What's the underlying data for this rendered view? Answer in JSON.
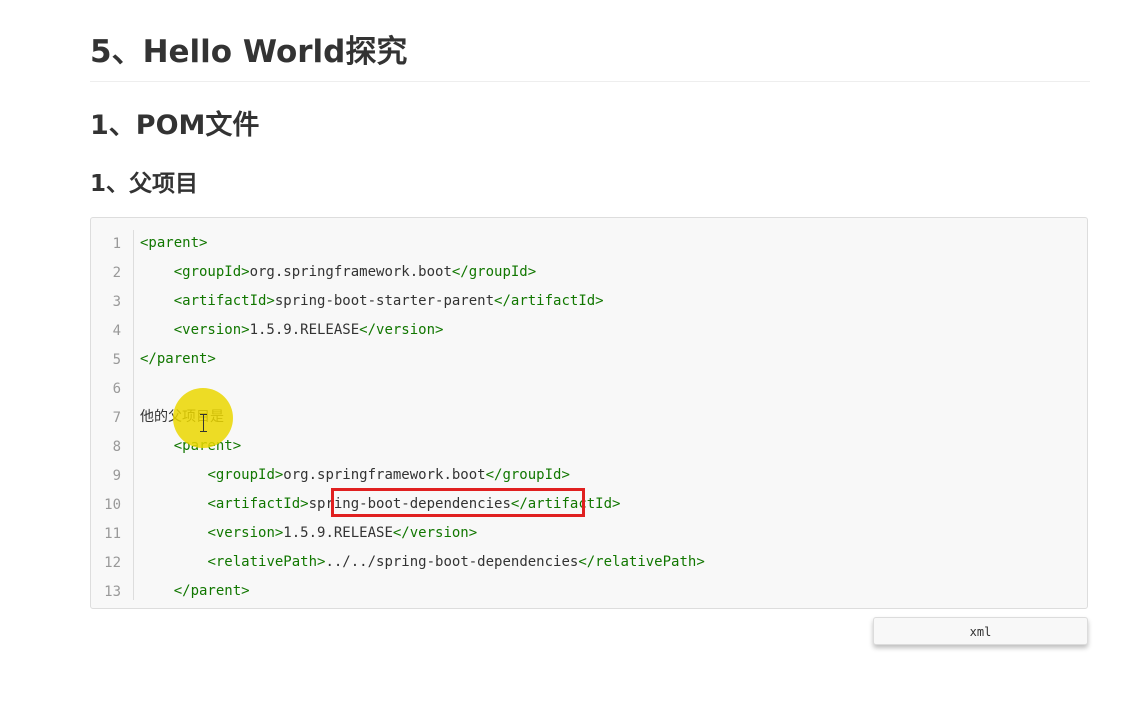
{
  "headings": {
    "main": "5、Hello World探究",
    "sub": "1、POM文件",
    "sub2": "1、父项目"
  },
  "code": {
    "line_numbers": [
      "1",
      "2",
      "3",
      "4",
      "5",
      "6",
      "7",
      "8",
      "9",
      "10",
      "11",
      "12",
      "13"
    ],
    "lines": {
      "l1_tag": "<parent>",
      "l2_open": "<groupId>",
      "l2_text": "org.springframework.boot",
      "l2_close": "</groupId>",
      "l3_open": "<artifactId>",
      "l3_text": "spring-boot-starter-parent",
      "l3_close": "</artifactId>",
      "l4_open": "<version>",
      "l4_text": "1.5.9.RELEASE",
      "l4_close": "</version>",
      "l5_tag": "</parent>",
      "l7_text": "他的父项目是",
      "l8_tag": "<parent>",
      "l9_open": "<groupId>",
      "l9_text": "org.springframework.boot",
      "l9_close": "</groupId>",
      "l10_open": "<artifactId>",
      "l10_text": "spring-boot-dependencies",
      "l10_close": "</artifactId>",
      "l11_open": "<version>",
      "l11_text": "1.5.9.RELEASE",
      "l11_close": "</version>",
      "l12_open": "<relativePath>",
      "l12_text": "../../spring-boot-dependencies",
      "l12_close": "</relativePath>",
      "l13_tag": "</parent>"
    },
    "language": "xml"
  },
  "colors": {
    "tag": "#117700",
    "highlight": "#e02020",
    "cursor_halo": "#ebd700"
  }
}
